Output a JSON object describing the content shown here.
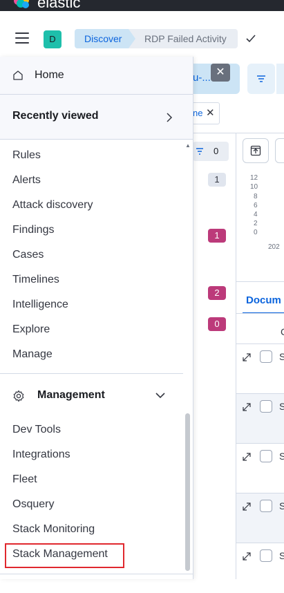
{
  "brand": {
    "name": "elastic"
  },
  "header": {
    "space_initial": "D",
    "breadcrumbs": [
      "Discover",
      "RDP Failed Activity"
    ]
  },
  "background": {
    "query_text": "u-...",
    "filter_pill_text": "ne",
    "filter_count": "0",
    "field_badges": [
      "1",
      "1",
      "2",
      "0"
    ],
    "chart_y_ticks": [
      "12",
      "10",
      "8",
      "6",
      "4",
      "2",
      "0"
    ],
    "chart_year": "202",
    "documents_tab": "Docum",
    "row_cell": "S"
  },
  "nav": {
    "home_label": "Home",
    "recently_viewed_label": "Recently viewed",
    "items": [
      "Rules",
      "Alerts",
      "Attack discovery",
      "Findings",
      "Cases",
      "Timelines",
      "Intelligence",
      "Explore",
      "Manage"
    ],
    "management_label": "Management",
    "management_items": [
      "Dev Tools",
      "Integrations",
      "Fleet",
      "Osquery",
      "Stack Monitoring",
      "Stack Management"
    ]
  },
  "colors": {
    "accent": "#0b64dd",
    "highlight": "#e0282e",
    "badge_pink": "#bc3a7a",
    "space_avatar": "#1ebfab"
  }
}
